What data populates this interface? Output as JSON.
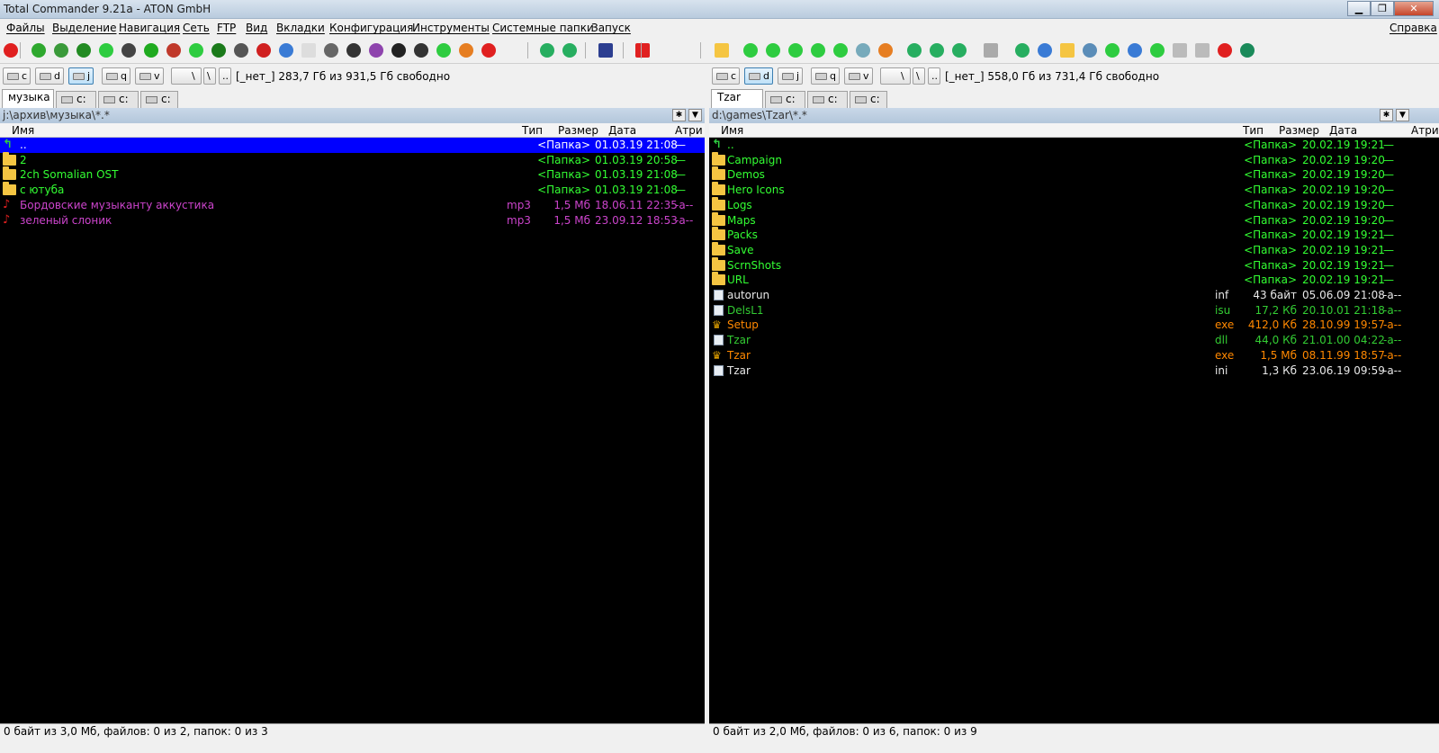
{
  "window": {
    "title": "Total Commander 9.21a - ATON GmbH"
  },
  "menu": [
    "Файлы",
    "Выделение",
    "Навигация",
    "Сеть",
    "FTP",
    "Вид",
    "Вкладки",
    "Конфигурация",
    "Инструменты",
    "Системные папки",
    "Запуск"
  ],
  "menu_right": "Справка",
  "left": {
    "drives": [
      "c",
      "d",
      "j",
      "q",
      "v"
    ],
    "active_drive": "j",
    "drive_info": "[_нет_]  283,7 Гб из 931,5 Гб свободно",
    "tabs": [
      "музыка",
      "c:",
      "c:",
      "c:"
    ],
    "path": "j:\\архив\\музыка\\*.*",
    "columns": {
      "name": "Имя",
      "ext": "Тип",
      "size": "Размер",
      "date": "Дата",
      "attr": "Атри"
    },
    "files": [
      {
        "icon": "up-icon",
        "name": "..",
        "ext": "",
        "size": "<Папка>",
        "date": "01.03.19 21:08",
        "attr": "—",
        "color": "#ffffff",
        "selected": true
      },
      {
        "icon": "folder-icon",
        "name": "2",
        "ext": "",
        "size": "<Папка>",
        "date": "01.03.19 20:58",
        "attr": "—",
        "color": "#33ff33"
      },
      {
        "icon": "folder-icon",
        "name": "2ch Somalian OST",
        "ext": "",
        "size": "<Папка>",
        "date": "01.03.19 21:08",
        "attr": "—",
        "color": "#33ff33"
      },
      {
        "icon": "folder-icon",
        "name": "с ютуба",
        "ext": "",
        "size": "<Папка>",
        "date": "01.03.19 21:08",
        "attr": "—",
        "color": "#33ff33"
      },
      {
        "icon": "music-icon",
        "name": "Бордовские музыканту аккустика",
        "ext": "mp3",
        "size": "1,5 Мб",
        "date": "18.06.11 22:35",
        "attr": "-a--",
        "color": "#cc44cc"
      },
      {
        "icon": "music-icon",
        "name": "зеленый слоник",
        "ext": "mp3",
        "size": "1,5 Мб",
        "date": "23.09.12 18:53",
        "attr": "-a--",
        "color": "#cc44cc"
      }
    ],
    "status": "0 байт из 3,0 Мб, файлов: 0 из 2, папок: 0 из 3"
  },
  "right": {
    "drives": [
      "c",
      "d",
      "j",
      "q",
      "v"
    ],
    "active_drive": "d",
    "drive_info": "[_нет_]  558,0 Гб из 731,4 Гб свободно",
    "tabs": [
      "Tzar",
      "c:",
      "c:",
      "c:"
    ],
    "path": "d:\\games\\Tzar\\*.*",
    "columns": {
      "name": "Имя",
      "ext": "Тип",
      "size": "Размер",
      "date": "Дата",
      "attr": "Атри"
    },
    "files": [
      {
        "icon": "up-icon",
        "name": "..",
        "ext": "",
        "size": "<Папка>",
        "date": "20.02.19 19:21",
        "attr": "—",
        "color": "#33ff33"
      },
      {
        "icon": "folder-icon",
        "name": "Campaign",
        "ext": "",
        "size": "<Папка>",
        "date": "20.02.19 19:20",
        "attr": "—",
        "color": "#33ff33"
      },
      {
        "icon": "folder-icon",
        "name": "Demos",
        "ext": "",
        "size": "<Папка>",
        "date": "20.02.19 19:20",
        "attr": "—",
        "color": "#33ff33"
      },
      {
        "icon": "folder-icon",
        "name": "Hero Icons",
        "ext": "",
        "size": "<Папка>",
        "date": "20.02.19 19:20",
        "attr": "—",
        "color": "#33ff33"
      },
      {
        "icon": "folder-icon",
        "name": "Logs",
        "ext": "",
        "size": "<Папка>",
        "date": "20.02.19 19:20",
        "attr": "—",
        "color": "#33ff33"
      },
      {
        "icon": "folder-icon",
        "name": "Maps",
        "ext": "",
        "size": "<Папка>",
        "date": "20.02.19 19:20",
        "attr": "—",
        "color": "#33ff33"
      },
      {
        "icon": "folder-icon",
        "name": "Packs",
        "ext": "",
        "size": "<Папка>",
        "date": "20.02.19 19:21",
        "attr": "—",
        "color": "#33ff33"
      },
      {
        "icon": "folder-icon",
        "name": "Save",
        "ext": "",
        "size": "<Папка>",
        "date": "20.02.19 19:21",
        "attr": "—",
        "color": "#33ff33"
      },
      {
        "icon": "folder-icon",
        "name": "ScrnShots",
        "ext": "",
        "size": "<Папка>",
        "date": "20.02.19 19:21",
        "attr": "—",
        "color": "#33ff33"
      },
      {
        "icon": "folder-icon",
        "name": "URL",
        "ext": "",
        "size": "<Папка>",
        "date": "20.02.19 19:21",
        "attr": "—",
        "color": "#33ff33"
      },
      {
        "icon": "file-icon",
        "name": "autorun",
        "ext": "inf",
        "size": "43 байт",
        "date": "05.06.09 21:08",
        "attr": "-a--",
        "color": "#e8e8e8"
      },
      {
        "icon": "file-icon",
        "name": "DelsL1",
        "ext": "isu",
        "size": "17,2 Кб",
        "date": "20.10.01 21:18",
        "attr": "-a--",
        "color": "#33cc33"
      },
      {
        "icon": "exe-icon",
        "name": "Setup",
        "ext": "exe",
        "size": "412,0 Кб",
        "date": "28.10.99 19:57",
        "attr": "-a--",
        "color": "#ff8800"
      },
      {
        "icon": "file-icon",
        "name": "Tzar",
        "ext": "dll",
        "size": "44,0 Кб",
        "date": "21.01.00 04:22",
        "attr": "-a--",
        "color": "#33cc33"
      },
      {
        "icon": "exe-icon",
        "name": "Tzar",
        "ext": "exe",
        "size": "1,5 Мб",
        "date": "08.11.99 18:57",
        "attr": "-a--",
        "color": "#ff8800"
      },
      {
        "icon": "file-icon",
        "name": "Tzar",
        "ext": "ini",
        "size": "1,3 Кб",
        "date": "23.06.19 09:59",
        "attr": "-a--",
        "color": "#e8e8e8"
      }
    ],
    "status": "0 байт из 2,0 Мб, файлов: 0 из 6, папок: 0 из 9"
  },
  "toolbar_icons": [
    "star-icon",
    "refresh-icon",
    "image-icon",
    "undo-icon",
    "grid-icon",
    "film-icon",
    "ftp-icon",
    "unpack-icon",
    "v-icon",
    "terminal-icon",
    "binoculars-icon",
    "o-icon",
    "globe-icon",
    "window-icon",
    "lock-icon",
    "r-icon",
    "color-icon",
    "aperture-icon",
    "contrast-icon",
    "gear-icon",
    "palette-icon",
    "star-icon",
    "back-icon",
    "download-icon",
    "save-icon",
    "delete-icon",
    "folder-icon",
    "down-icon",
    "down-icon",
    "down-icon",
    "down-icon",
    "down-icon",
    "tree-icon",
    "shape-icon",
    "rewind-icon",
    "play-icon",
    "forward-icon",
    "search-icon",
    "up-icon",
    "map-icon",
    "folder-icon",
    "network-icon",
    "puzzle-icon",
    "calendar-icon",
    "f6-icon",
    "zoom-icon",
    "zoom-icon",
    "splat-icon",
    "vote-icon"
  ]
}
